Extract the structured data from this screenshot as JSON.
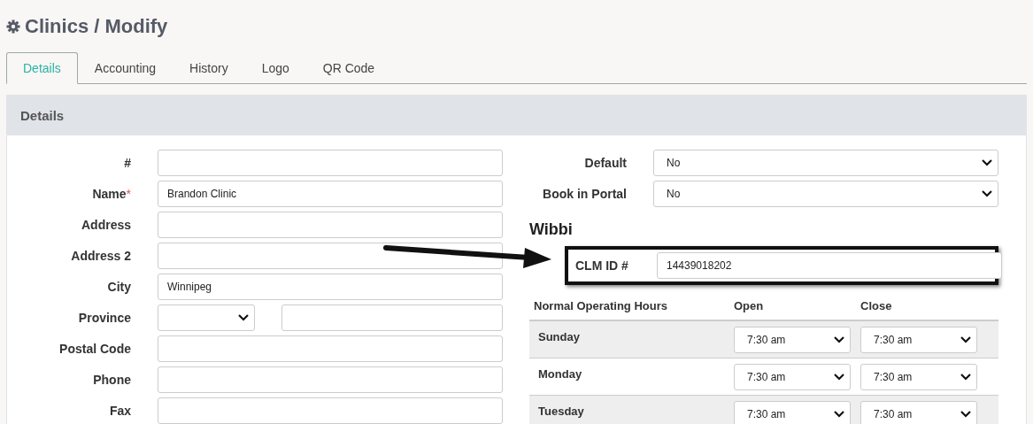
{
  "page_title": "Clinics / Modify",
  "tabs": [
    {
      "label": "Details",
      "selected": true
    },
    {
      "label": "Accounting",
      "selected": false
    },
    {
      "label": "History",
      "selected": false
    },
    {
      "label": "Logo",
      "selected": false
    },
    {
      "label": "QR Code",
      "selected": false
    }
  ],
  "panel": {
    "title": "Details"
  },
  "left_fields": [
    {
      "label": "#",
      "kind": "text"
    },
    {
      "label": "Name",
      "required_mark": "*",
      "kind": "text",
      "value": "Brandon Clinic"
    },
    {
      "label": "Address",
      "kind": "text"
    },
    {
      "label": "Address 2",
      "kind": "text"
    },
    {
      "label": "City",
      "kind": "text",
      "value": "Winnipeg"
    },
    {
      "label": "Province",
      "kind": "select_text"
    },
    {
      "label": "Postal Code",
      "kind": "text"
    },
    {
      "label": "Phone",
      "kind": "text"
    },
    {
      "label": "Fax",
      "kind": "text"
    }
  ],
  "right_fields": [
    {
      "label": "Default",
      "value": "No"
    },
    {
      "label": "Book in Portal",
      "value": "No"
    }
  ],
  "wibbi": {
    "title": "Wibbi",
    "label": "CLM ID #",
    "value": "14439018202",
    "highlighted": true
  },
  "hours": {
    "headers": [
      "Normal Operating Hours",
      "Open",
      "Close"
    ],
    "days": [
      {
        "day": "Sunday",
        "open": "7:30 am",
        "close": "7:30 am"
      },
      {
        "day": "Monday",
        "open": "7:30 am",
        "close": "7:30 am"
      },
      {
        "day": "Tuesday",
        "open": "7:30 am",
        "close": "7:30 am"
      }
    ]
  }
}
